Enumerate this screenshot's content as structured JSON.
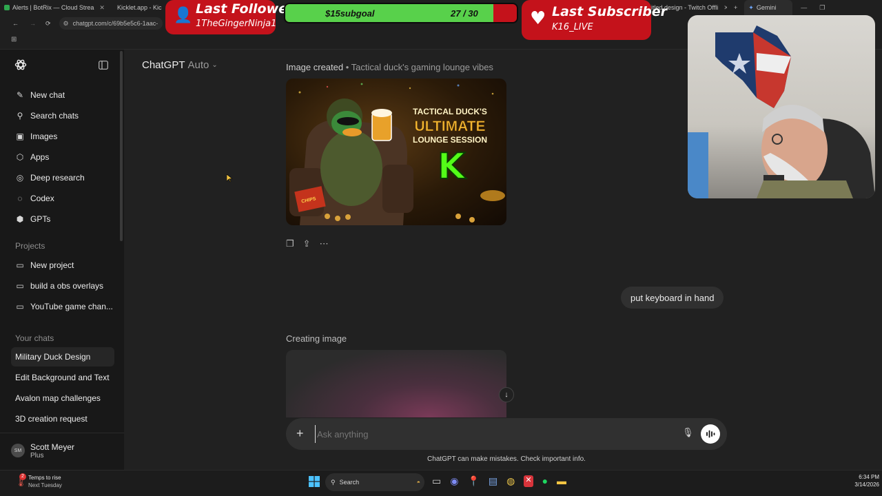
{
  "browser": {
    "tabs": [
      {
        "label": "Alerts | BotRix — Cloud Strea"
      },
      {
        "label": "Kicklet.app - Kic"
      },
      {
        "label": "Untitled design - Twitch Offli"
      },
      {
        "label": "Gemini"
      }
    ],
    "url": "chatgpt.com/c/69b5e5c6-1aac-"
  },
  "overlay": {
    "follower": {
      "title": "Last Follower",
      "name": "1TheGingerNinja1"
    },
    "goal": {
      "label": "$15subgoal",
      "count": "27 / 30",
      "progress": 0.9
    },
    "subscriber": {
      "title": "Last Subscriber",
      "name": "K16_LIVE"
    }
  },
  "sidebar": {
    "nav": [
      {
        "label": "New chat",
        "icon": "edit-icon"
      },
      {
        "label": "Search chats",
        "icon": "search-icon"
      },
      {
        "label": "Images",
        "icon": "image-icon"
      },
      {
        "label": "Apps",
        "icon": "apps-icon"
      },
      {
        "label": "Deep research",
        "icon": "telescope-icon"
      },
      {
        "label": "Codex",
        "icon": "codex-icon"
      },
      {
        "label": "GPTs",
        "icon": "cube-icon"
      }
    ],
    "projects_heading": "Projects",
    "projects": [
      {
        "label": "New project"
      },
      {
        "label": "build a obs overlays"
      },
      {
        "label": "YouTube game chan..."
      }
    ],
    "chats_heading": "Your chats",
    "chats": [
      {
        "label": "Military Duck Design"
      },
      {
        "label": "Edit Background and Text"
      },
      {
        "label": "Avalon map challenges"
      },
      {
        "label": "3D creation request"
      }
    ],
    "user": {
      "initials": "SM",
      "name": "Scott Meyer",
      "plan": "Plus"
    }
  },
  "header": {
    "model": "ChatGPT",
    "mode": "Auto"
  },
  "conversation": {
    "image_status": "Image created",
    "image_title": "Tactical duck's gaming lounge vibes",
    "image_text": {
      "line1": "TACTICAL DUCK'S",
      "line2": "ULTIMATE",
      "line3": "LOUNGE SESSION",
      "logo": "K",
      "chips": "CHIPS"
    },
    "user_message": "put keyboard in hand",
    "creating_status": "Creating image"
  },
  "composer": {
    "placeholder": "Ask anything"
  },
  "disclaimer": "ChatGPT can make mistakes. Check important info.",
  "taskbar": {
    "weather_badge": "2",
    "weather_line1": "Temps to rise",
    "weather_line2": "Next Tuesday",
    "search_label": "Search",
    "time": "6:34 PM",
    "date": "3/14/2026"
  },
  "colors": {
    "accent_red": "#c4121b",
    "goal_green": "#58d14b",
    "page_bg": "#212121",
    "sidebar_bg": "#181818"
  }
}
